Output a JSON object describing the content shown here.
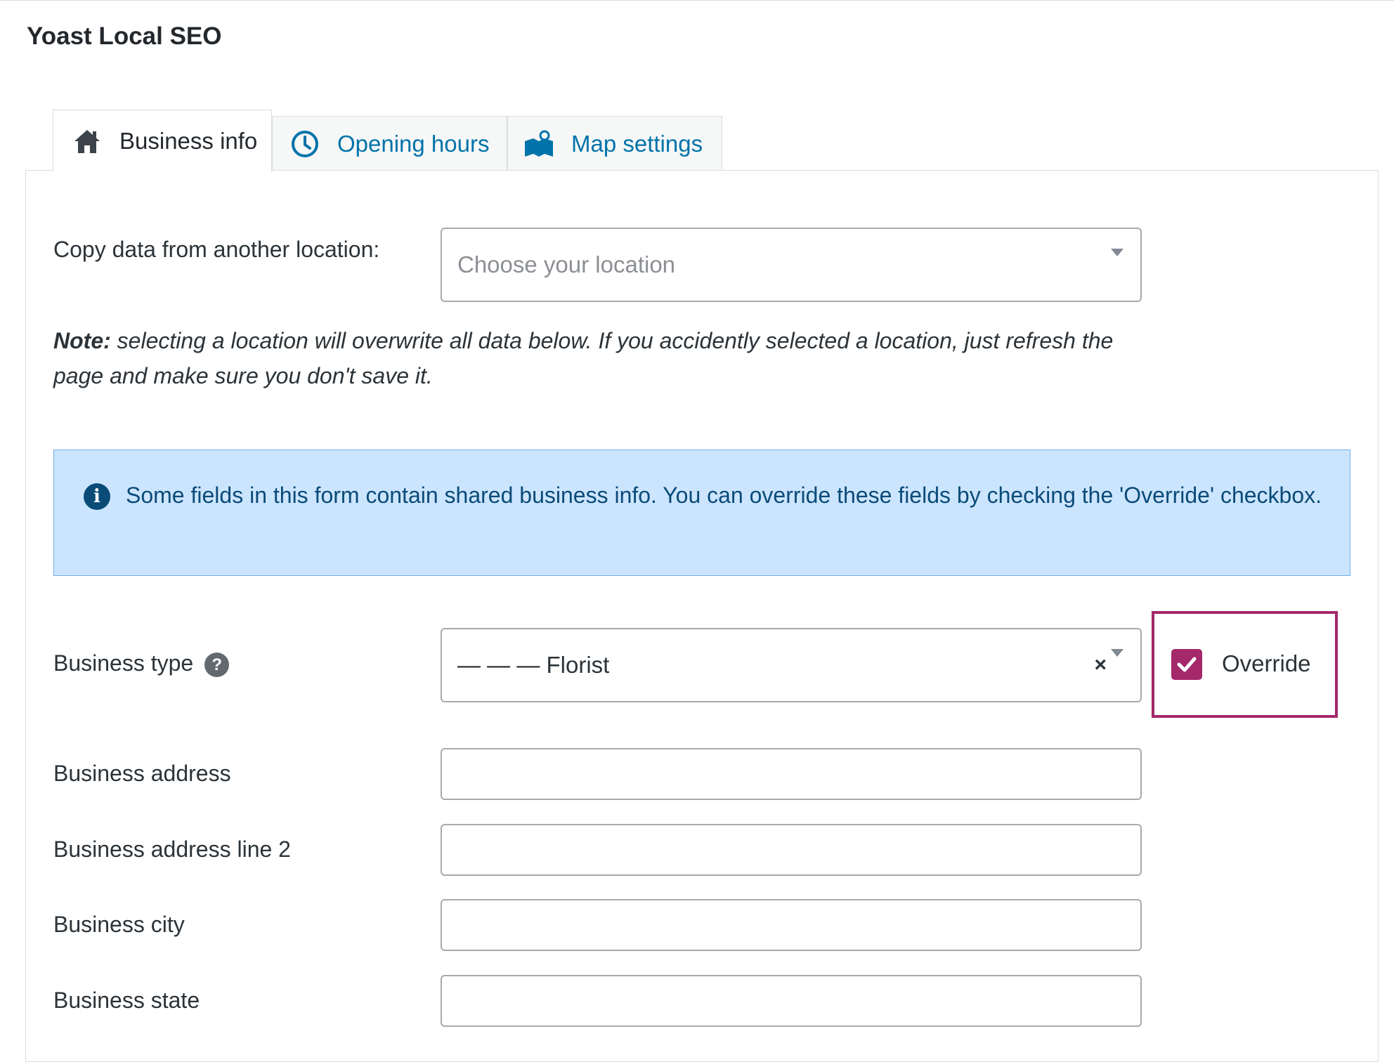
{
  "page": {
    "title": "Yoast Local SEO"
  },
  "tabs": [
    {
      "label": "Business info",
      "icon": "home-icon",
      "active": true
    },
    {
      "label": "Opening hours",
      "icon": "clock-icon",
      "active": false
    },
    {
      "label": "Map settings",
      "icon": "map-pin-icon",
      "active": false
    }
  ],
  "copy_location": {
    "label": "Copy data from another location:",
    "placeholder": "Choose your location"
  },
  "note": {
    "prefix": "Note:",
    "text": " selecting a location will overwrite all data below. If you accidently selected a location, just refresh the page and make sure you don't save it."
  },
  "info_notice": {
    "text": "Some fields in this form contain shared business info. You can override these fields by checking the 'Override' checkbox."
  },
  "business_type": {
    "label": "Business type",
    "help": "?",
    "value": "— — — Florist",
    "clear": "×"
  },
  "override": {
    "label": "Override",
    "checked": true
  },
  "fields": [
    {
      "label": "Business address",
      "value": ""
    },
    {
      "label": "Business address line 2",
      "value": ""
    },
    {
      "label": "Business city",
      "value": ""
    },
    {
      "label": "Business state",
      "value": ""
    }
  ],
  "colors": {
    "link": "#0073aa",
    "notice_bg": "#cce5ff",
    "notice_text": "#0a4b78",
    "override_accent": "#a4286a"
  }
}
